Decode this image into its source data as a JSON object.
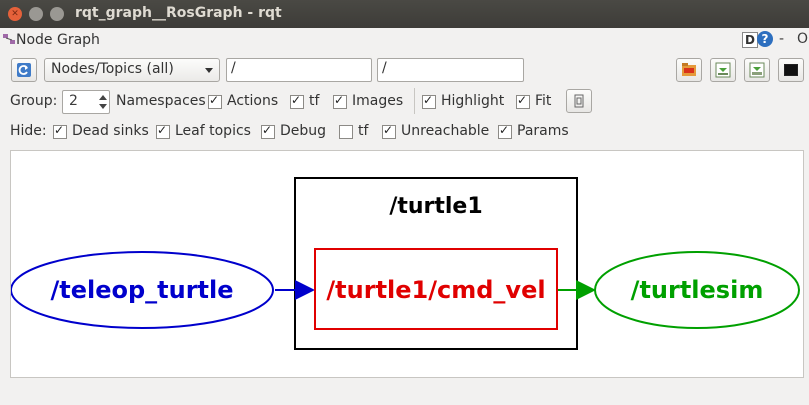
{
  "window": {
    "title": "rqt_graph__RosGraph - rqt"
  },
  "panel": {
    "title": "Node Graph",
    "help_label": "D",
    "help_q": "?",
    "dash": "-",
    "o_label": "O"
  },
  "toolbar": {
    "view_mode": "Nodes/Topics (all)",
    "node_filter": "/",
    "topic_filter": "/"
  },
  "options": {
    "group_label": "Group:",
    "group_value": "2",
    "namespaces": "Namespaces",
    "actions": "Actions",
    "tf": "tf",
    "images": "Images",
    "highlight": "Highlight",
    "fit": "Fit"
  },
  "hide": {
    "label": "Hide:",
    "dead_sinks": "Dead sinks",
    "leaf_topics": "Leaf topics",
    "debug": "Debug",
    "tf": "tf",
    "unreachable": "Unreachable",
    "params": "Params"
  },
  "graph": {
    "cluster_label": "/turtle1",
    "node_teleop": "/teleop_turtle",
    "topic_cmd_vel": "/turtle1/cmd_vel",
    "node_turtlesim": "/turtlesim",
    "colors": {
      "teleop": "#0000cc",
      "topic": "#e00000",
      "turtlesim": "#00a000"
    }
  }
}
